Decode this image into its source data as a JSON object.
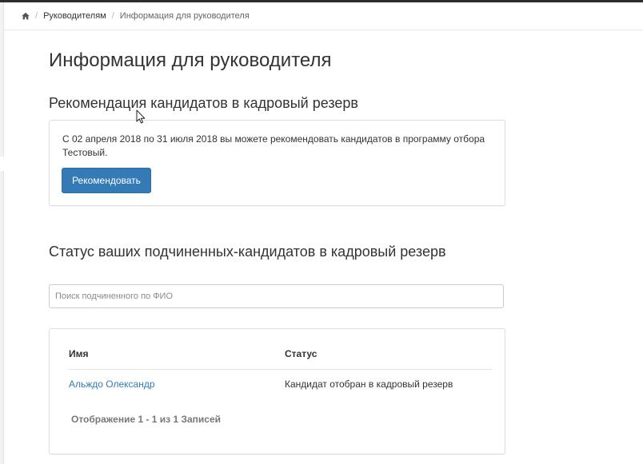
{
  "breadcrumb": {
    "home_icon": "home-icon",
    "items": [
      "Руководителям",
      "Информация для руководителя"
    ]
  },
  "page_title": "Информация для руководителя",
  "recommend_section": {
    "title": "Рекомендация кандидатов в кадровый резерв",
    "text": "С 02 апреля 2018 по 31 июля 2018 вы можете рекомендовать кандидатов в программу отбора Тестовый.",
    "button_label": "Рекомендовать"
  },
  "status_section": {
    "title": "Статус ваших подчиненных-кандидатов в кадровый резерв",
    "search_placeholder": "Поиск подчиненного по ФИО",
    "table": {
      "headers": [
        "Имя",
        "Статус"
      ],
      "rows": [
        {
          "name": "Альждо Олександр",
          "status": "Кандидат отобран в кадровый резерв"
        }
      ]
    },
    "paging_info": "Отображение 1 - 1 из 1 Записей"
  },
  "colors": {
    "primary": "#337ab7",
    "link": "#337ab7",
    "text": "#333333",
    "muted": "#777777"
  }
}
